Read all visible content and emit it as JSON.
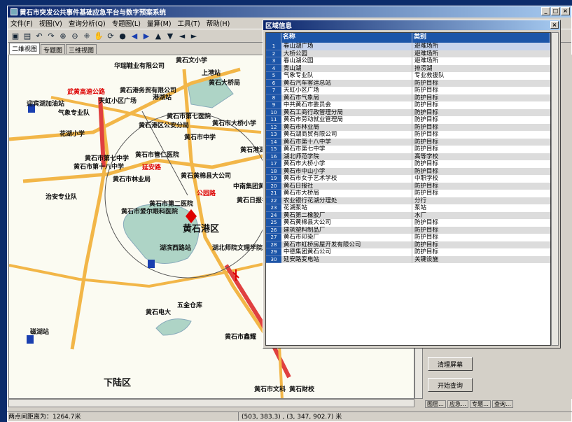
{
  "window": {
    "title": "黄石市突发公共事件基础应急平台与数字预案系统",
    "buttons": [
      "_",
      "□",
      "×"
    ]
  },
  "menu": [
    "文件(F)",
    "视图(V)",
    "查询分析(Q)",
    "专题图(L)",
    "量算(M)",
    "工具(T)",
    "帮助(H)"
  ],
  "toolbar_icons": [
    "save-icon",
    "open-icon",
    "undo-icon",
    "redo-icon",
    "zoom-in-icon",
    "zoom-out-icon",
    "full-extent-icon",
    "pan-icon",
    "refresh-icon",
    "globe-icon",
    "back-icon",
    "forward-icon",
    "up-icon",
    "down-icon",
    "left-icon",
    "right-icon"
  ],
  "map_tabs": [
    "二维视图",
    "专题图",
    "三维视图"
  ],
  "map": {
    "labels": [
      {
        "text": "华瑞鞋业有限公司",
        "cls": ""
      },
      {
        "text": "黄石文小学",
        "cls": ""
      },
      {
        "text": "上港站",
        "cls": ""
      },
      {
        "text": "黄石大桥局",
        "cls": ""
      },
      {
        "text": "武黄高速公路",
        "cls": "red"
      },
      {
        "text": "黄石港务贸有限公司",
        "cls": ""
      },
      {
        "text": "港湖站",
        "cls": ""
      },
      {
        "text": "天虹小区广场",
        "cls": ""
      },
      {
        "text": "迎宾湖加油站",
        "cls": ""
      },
      {
        "text": "气象专业队",
        "cls": ""
      },
      {
        "text": "黄石市第七医院",
        "cls": ""
      },
      {
        "text": "黄石市大桥小学",
        "cls": ""
      },
      {
        "text": "花湖小学",
        "cls": ""
      },
      {
        "text": "黄石港区公安分局",
        "cls": ""
      },
      {
        "text": "黄石市中学",
        "cls": ""
      },
      {
        "text": "黄石港湖北",
        "cls": ""
      },
      {
        "text": "黄石市第七中学",
        "cls": ""
      },
      {
        "text": "黄石市第十八中学",
        "cls": ""
      },
      {
        "text": "黄石市管仁医院",
        "cls": ""
      },
      {
        "text": "黄石市林业局",
        "cls": ""
      },
      {
        "text": "黄石黄棉县大公司",
        "cls": ""
      },
      {
        "text": "中南集团黄石",
        "cls": ""
      },
      {
        "text": "治安专业队",
        "cls": ""
      },
      {
        "text": "公园路",
        "cls": "red"
      },
      {
        "text": "黄石市第二医院",
        "cls": ""
      },
      {
        "text": "黄石日报社",
        "cls": ""
      },
      {
        "text": "黄石市爱尔眼科医院",
        "cls": ""
      },
      {
        "text": "黄石港区",
        "cls": "big"
      },
      {
        "text": "湖滨西路站",
        "cls": ""
      },
      {
        "text": "湖北师院文理学院",
        "cls": ""
      },
      {
        "text": "五金仓库",
        "cls": ""
      },
      {
        "text": "黄石电大",
        "cls": ""
      },
      {
        "text": "磁湖站",
        "cls": ""
      },
      {
        "text": "黄石市鑫耀",
        "cls": ""
      },
      {
        "text": "下陆区",
        "cls": "big"
      },
      {
        "text": "黄石市文科",
        "cls": ""
      },
      {
        "text": "黄石财校",
        "cls": ""
      },
      {
        "text": "延安路",
        "cls": "red"
      }
    ]
  },
  "status": {
    "distance": "两点间距离为：1264.7米",
    "coords": "(503, 383.3) , (3, 347, 902.7) 米"
  },
  "side_buttons": {
    "clear": "清理屏幕",
    "query": "开始查询"
  },
  "bottom_tabs": [
    "图层…",
    "应急…",
    "专题…",
    "查询…"
  ],
  "dialog": {
    "title": "区域信息",
    "columns": [
      "名称",
      "类别"
    ],
    "rows": [
      [
        "1",
        "春山湖广场",
        "避难场所"
      ],
      [
        "2",
        "大桥公园",
        "避难场所"
      ],
      [
        "3",
        "春山湖公园",
        "避难场所"
      ],
      [
        "4",
        "青山湖",
        "排涝湖"
      ],
      [
        "5",
        "气象专业队",
        "专业救援队"
      ],
      [
        "6",
        "黄石汽车客运总站",
        "防护目标"
      ],
      [
        "7",
        "天虹小区广场",
        "防护目标"
      ],
      [
        "8",
        "黄石市气象局",
        "防护目标"
      ],
      [
        "9",
        "中共黄石市委员会",
        "防护目标"
      ],
      [
        "10",
        "黄石工商行政管理分局",
        "防护目标"
      ],
      [
        "11",
        "黄石市劳动就业管理局",
        "防护目标"
      ],
      [
        "12",
        "黄石市林业局",
        "防护目标"
      ],
      [
        "13",
        "黄石湖商贸有限公司",
        "防护目标"
      ],
      [
        "14",
        "黄石市第十八中学",
        "防护目标"
      ],
      [
        "15",
        "黄石市第七中学",
        "防护目标"
      ],
      [
        "16",
        "湖北师范学院",
        "高等学校"
      ],
      [
        "17",
        "黄石市大桥小学",
        "防护目标"
      ],
      [
        "18",
        "黄石市中山小学",
        "防护目标"
      ],
      [
        "19",
        "黄石市女子艺术学校",
        "中职学校"
      ],
      [
        "20",
        "黄石日报社",
        "防护目标"
      ],
      [
        "21",
        "黄石市大桥局",
        "防护目标"
      ],
      [
        "22",
        "农业银行花湖分理处",
        "分行"
      ],
      [
        "23",
        "花湖泵站",
        "泵站"
      ],
      [
        "24",
        "黄石第二橡胶厂",
        "水厂"
      ],
      [
        "25",
        "黄石黄棉县大公司",
        "防护目标"
      ],
      [
        "26",
        "建筑塑料制品厂",
        "防护目标"
      ],
      [
        "27",
        "黄石市印染厂",
        "防护目标"
      ],
      [
        "28",
        "黄石市虹桥房屋开发有限公司",
        "防护目标"
      ],
      [
        "29",
        "中德集团黄石公司",
        "防护目标"
      ],
      [
        "30",
        "延安路变电站",
        "关键设施"
      ]
    ]
  },
  "colors": {
    "title_bg": "#0a246a",
    "grid_header": "#1c55a8",
    "road_red": "#d00",
    "water": "#aed4c6",
    "road_orange": "#f2b648"
  }
}
